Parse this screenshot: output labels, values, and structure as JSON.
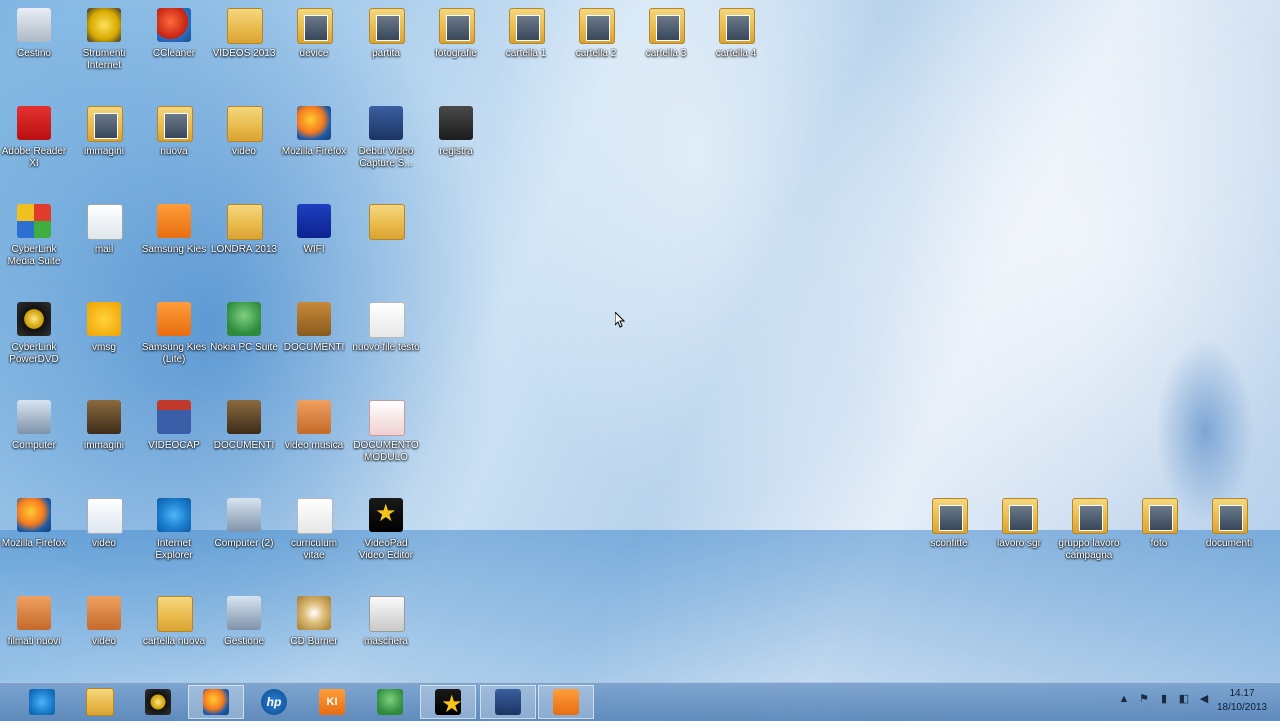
{
  "desktop": {
    "icons": [
      {
        "label": "Cestino"
      },
      {
        "label": "Strumenti Internet"
      },
      {
        "label": "CCleaner"
      },
      {
        "label": "VIDEOS 2013"
      },
      {
        "label": "device"
      },
      {
        "label": "partita"
      },
      {
        "label": "fotografie"
      },
      {
        "label": "cartella 1"
      },
      {
        "label": "cartella 2"
      },
      {
        "label": "cartella 3"
      },
      {
        "label": "cartella 4"
      },
      {
        "label": "Adobe Reader XI"
      },
      {
        "label": "immagini"
      },
      {
        "label": "nuova"
      },
      {
        "label": "video"
      },
      {
        "label": "Mozilla Firefox"
      },
      {
        "label": "Debut Video Capture S..."
      },
      {
        "label": "registra"
      },
      {
        "label": "CyberLink Media Suite"
      },
      {
        "label": "mail"
      },
      {
        "label": "Samsung Kies"
      },
      {
        "label": "LONDRA 2013"
      },
      {
        "label": "WIFI"
      },
      {
        "label": ""
      },
      {
        "label": "CyberLink PowerDVD"
      },
      {
        "label": "vmsg"
      },
      {
        "label": "Samsung Kies (Lite)"
      },
      {
        "label": "Nokia PC Suite"
      },
      {
        "label": "DOCUMENTI"
      },
      {
        "label": "nuovo file testo"
      },
      {
        "label": "Computer"
      },
      {
        "label": "immagini"
      },
      {
        "label": "VIDEOCAP"
      },
      {
        "label": "DOCUMENTI"
      },
      {
        "label": "video musica"
      },
      {
        "label": "DOCUMENTO MODULO"
      },
      {
        "label": "Mozilla Firefox"
      },
      {
        "label": "video"
      },
      {
        "label": "Internet Explorer"
      },
      {
        "label": "Computer (2)"
      },
      {
        "label": "curriculum vitae"
      },
      {
        "label": "VideoPad Video Editor"
      },
      {
        "label": "filmati nuovi"
      },
      {
        "label": "video"
      },
      {
        "label": "cartella nuova"
      },
      {
        "label": "Gestione"
      },
      {
        "label": "CD Burner"
      },
      {
        "label": "maschera"
      },
      {
        "label": "sconfitte"
      },
      {
        "label": "lavoro sgr"
      },
      {
        "label": "gruppo lavoro campagna"
      },
      {
        "label": "foto"
      },
      {
        "label": "documenti"
      }
    ]
  },
  "taskbar": {
    "items": [
      {
        "name": "internet-explorer"
      },
      {
        "name": "file-explorer"
      },
      {
        "name": "powerdvd"
      },
      {
        "name": "firefox"
      },
      {
        "name": "hp",
        "text": "hp"
      },
      {
        "name": "kies",
        "text": "KI"
      },
      {
        "name": "nokia"
      },
      {
        "name": "videopad"
      },
      {
        "name": "debut"
      },
      {
        "name": "kies-lite"
      }
    ],
    "clock": {
      "time": "14.17",
      "date": "18/10/2013"
    }
  }
}
